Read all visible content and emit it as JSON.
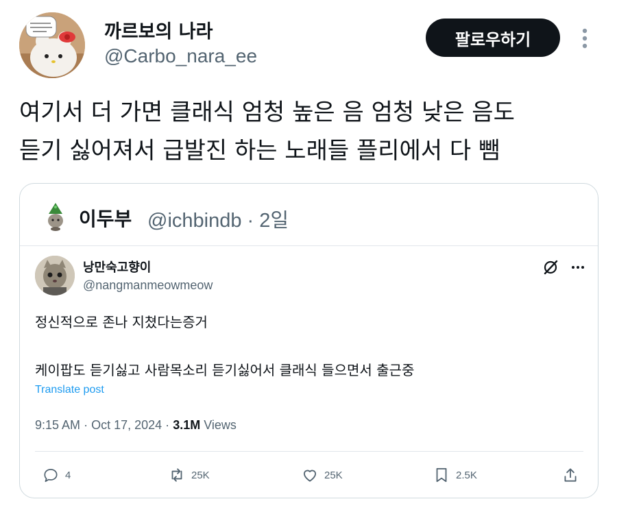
{
  "author": {
    "display_name": "까르보의 나라",
    "handle": "@Carbo_nara_ee",
    "avatar_icon": "hello-kitty-plush-avatar"
  },
  "follow_button_label": "팔로우하기",
  "more_icon": "more-vertical-icon",
  "tweet": {
    "line1": "여기서 더 가면 클래식 엄청 높은 음 엄청 낮은 음도",
    "line2": "듣기 싫어져서 급발진 하는 노래들 플리에서 다 뺌"
  },
  "quote": {
    "name": "이두부",
    "handle": "@ichbindb",
    "separator": "·",
    "age": "2일",
    "avatar_icon": "green-sprout-cat-avatar"
  },
  "inner_post": {
    "name": "낭만숙고향이",
    "handle": "@nangmanmeowmeow",
    "line1": "정신적으로 존나 지쳤다는증거",
    "line2": "케이팝도 듣기싫고 사람목소리 듣기싫어서 클래식 들으면서 출근중",
    "translate_label": "Translate post",
    "time": "9:15 AM",
    "dot1": "·",
    "date": "Oct 17, 2024",
    "dot2": "·",
    "views": "3.1M",
    "views_label": "Views",
    "actions": {
      "replies": "4",
      "reposts": "25K",
      "likes": "25K",
      "bookmarks": "2.5K"
    }
  },
  "colors": {
    "text": "#0f1419",
    "muted": "#536471",
    "link": "#1d9bf0",
    "border": "#cfd9de",
    "button_bg": "#0f1419"
  }
}
